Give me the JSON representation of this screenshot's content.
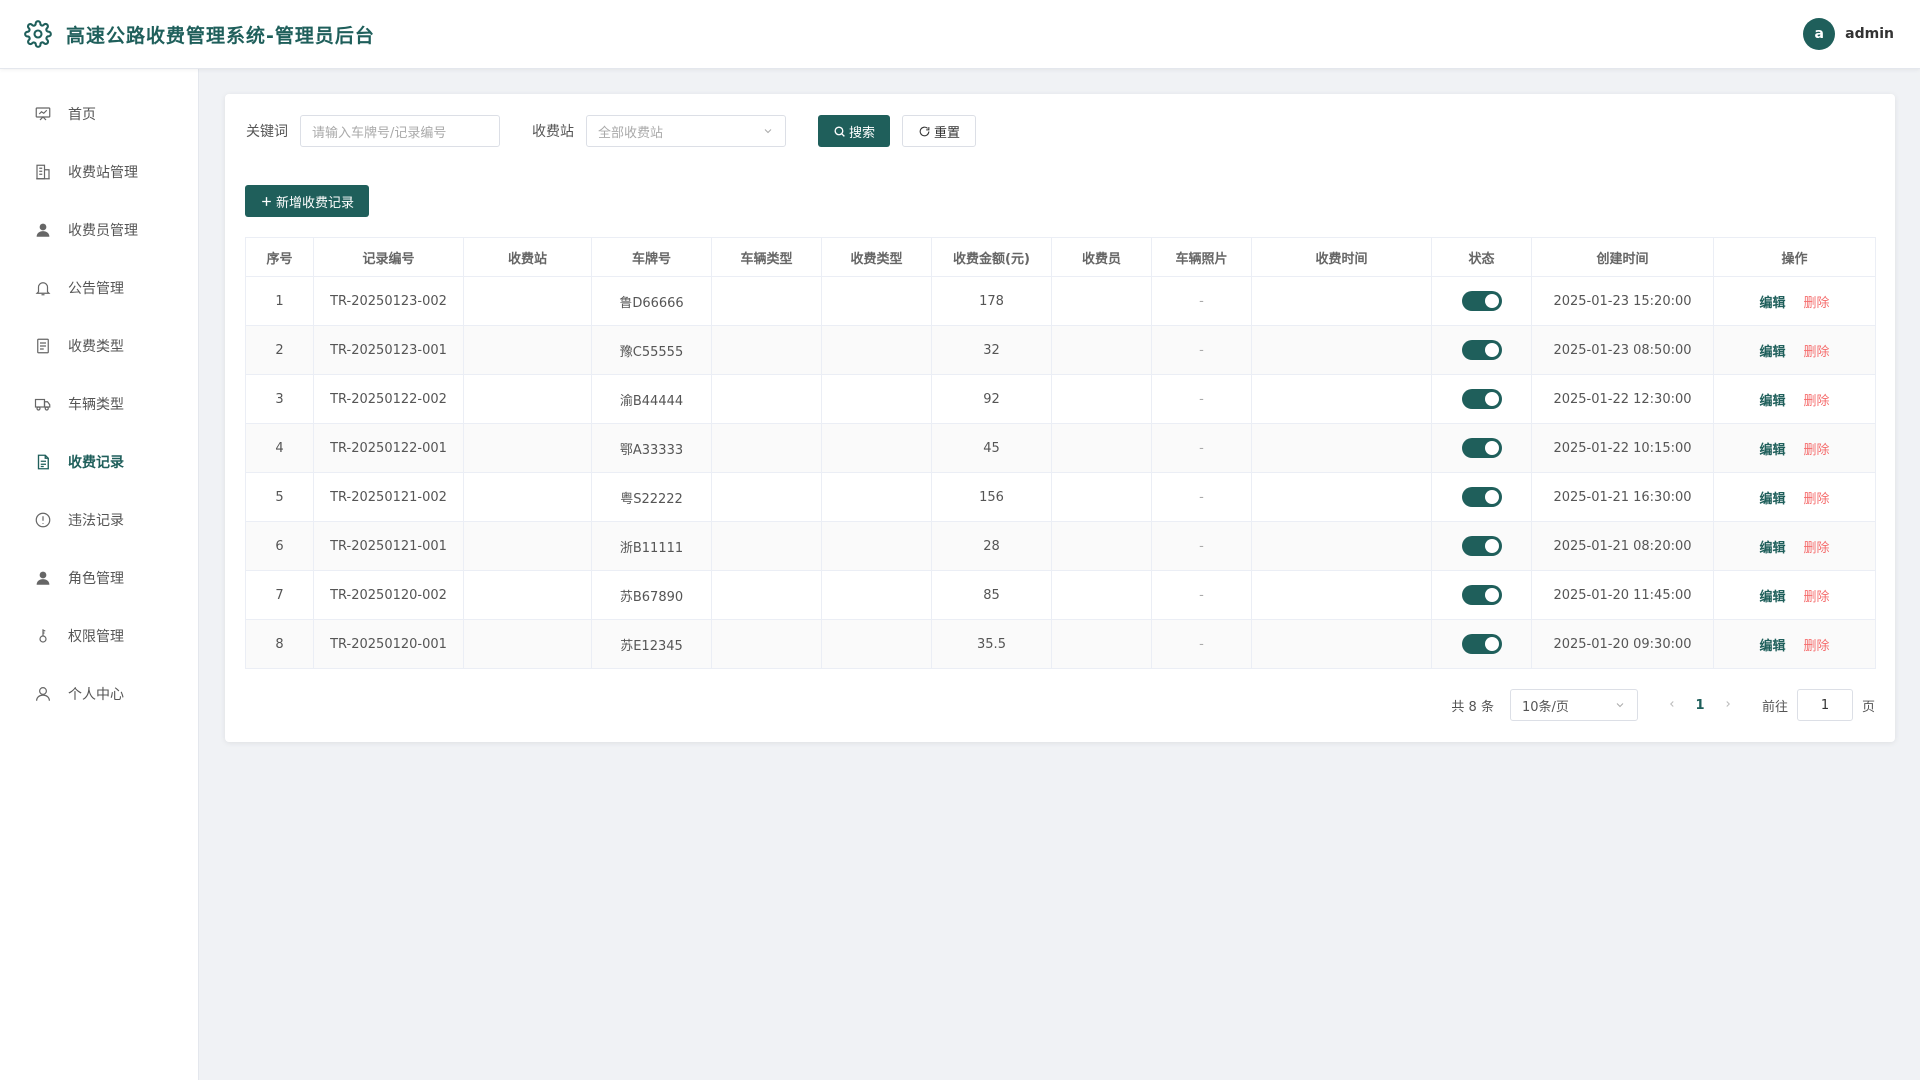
{
  "header": {
    "title": "高速公路收费管理系统-管理员后台",
    "avatar_letter": "a",
    "username": "admin",
    "accent_color": "#1f5f5b"
  },
  "sidebar": {
    "items": [
      {
        "label": "首页",
        "icon": "dashboard-icon"
      },
      {
        "label": "收费站管理",
        "icon": "building-icon"
      },
      {
        "label": "收费员管理",
        "icon": "user-icon"
      },
      {
        "label": "公告管理",
        "icon": "bell-icon"
      },
      {
        "label": "收费类型",
        "icon": "document-icon"
      },
      {
        "label": "车辆类型",
        "icon": "truck-icon"
      },
      {
        "label": "收费记录",
        "icon": "record-icon",
        "active": true
      },
      {
        "label": "违法记录",
        "icon": "warning-icon"
      },
      {
        "label": "角色管理",
        "icon": "user-icon"
      },
      {
        "label": "权限管理",
        "icon": "key-icon"
      },
      {
        "label": "个人中心",
        "icon": "user-outline-icon"
      }
    ]
  },
  "filters": {
    "keyword_label": "关键词",
    "keyword_placeholder": "请输入车牌号/记录编号",
    "station_label": "收费站",
    "station_value": "全部收费站",
    "search_label": "搜索",
    "reset_label": "重置"
  },
  "add_button_label": "新增收费记录",
  "table": {
    "columns": [
      "序号",
      "记录编号",
      "收费站",
      "车牌号",
      "车辆类型",
      "收费类型",
      "收费金额(元)",
      "收费员",
      "车辆照片",
      "收费时间",
      "状态",
      "创建时间",
      "操作"
    ],
    "rows": [
      {
        "index": "1",
        "record_no": "TR-20250123-002",
        "station": "",
        "plate": "鲁D66666",
        "vehicle_type": "",
        "fee_type": "",
        "amount": "178",
        "collector": "",
        "photo": "-",
        "toll_time": "",
        "status_on": true,
        "created": "2025-01-23 15:20:00"
      },
      {
        "index": "2",
        "record_no": "TR-20250123-001",
        "station": "",
        "plate": "豫C55555",
        "vehicle_type": "",
        "fee_type": "",
        "amount": "32",
        "collector": "",
        "photo": "-",
        "toll_time": "",
        "status_on": true,
        "created": "2025-01-23 08:50:00"
      },
      {
        "index": "3",
        "record_no": "TR-20250122-002",
        "station": "",
        "plate": "渝B44444",
        "vehicle_type": "",
        "fee_type": "",
        "amount": "92",
        "collector": "",
        "photo": "-",
        "toll_time": "",
        "status_on": true,
        "created": "2025-01-22 12:30:00"
      },
      {
        "index": "4",
        "record_no": "TR-20250122-001",
        "station": "",
        "plate": "鄂A33333",
        "vehicle_type": "",
        "fee_type": "",
        "amount": "45",
        "collector": "",
        "photo": "-",
        "toll_time": "",
        "status_on": true,
        "created": "2025-01-22 10:15:00"
      },
      {
        "index": "5",
        "record_no": "TR-20250121-002",
        "station": "",
        "plate": "粤S22222",
        "vehicle_type": "",
        "fee_type": "",
        "amount": "156",
        "collector": "",
        "photo": "-",
        "toll_time": "",
        "status_on": true,
        "created": "2025-01-21 16:30:00"
      },
      {
        "index": "6",
        "record_no": "TR-20250121-001",
        "station": "",
        "plate": "浙B11111",
        "vehicle_type": "",
        "fee_type": "",
        "amount": "28",
        "collector": "",
        "photo": "-",
        "toll_time": "",
        "status_on": true,
        "created": "2025-01-21 08:20:00"
      },
      {
        "index": "7",
        "record_no": "TR-20250120-002",
        "station": "",
        "plate": "苏B67890",
        "vehicle_type": "",
        "fee_type": "",
        "amount": "85",
        "collector": "",
        "photo": "-",
        "toll_time": "",
        "status_on": true,
        "created": "2025-01-20 11:45:00"
      },
      {
        "index": "8",
        "record_no": "TR-20250120-001",
        "station": "",
        "plate": "苏E12345",
        "vehicle_type": "",
        "fee_type": "",
        "amount": "35.5",
        "collector": "",
        "photo": "-",
        "toll_time": "",
        "status_on": true,
        "created": "2025-01-20 09:30:00"
      }
    ],
    "edit_label": "编辑",
    "delete_label": "删除"
  },
  "pagination": {
    "total_text": "共 8 条",
    "page_size": "10条/页",
    "current_page": "1",
    "goto_label": "前往",
    "goto_value": "1",
    "page_suffix": "页"
  }
}
